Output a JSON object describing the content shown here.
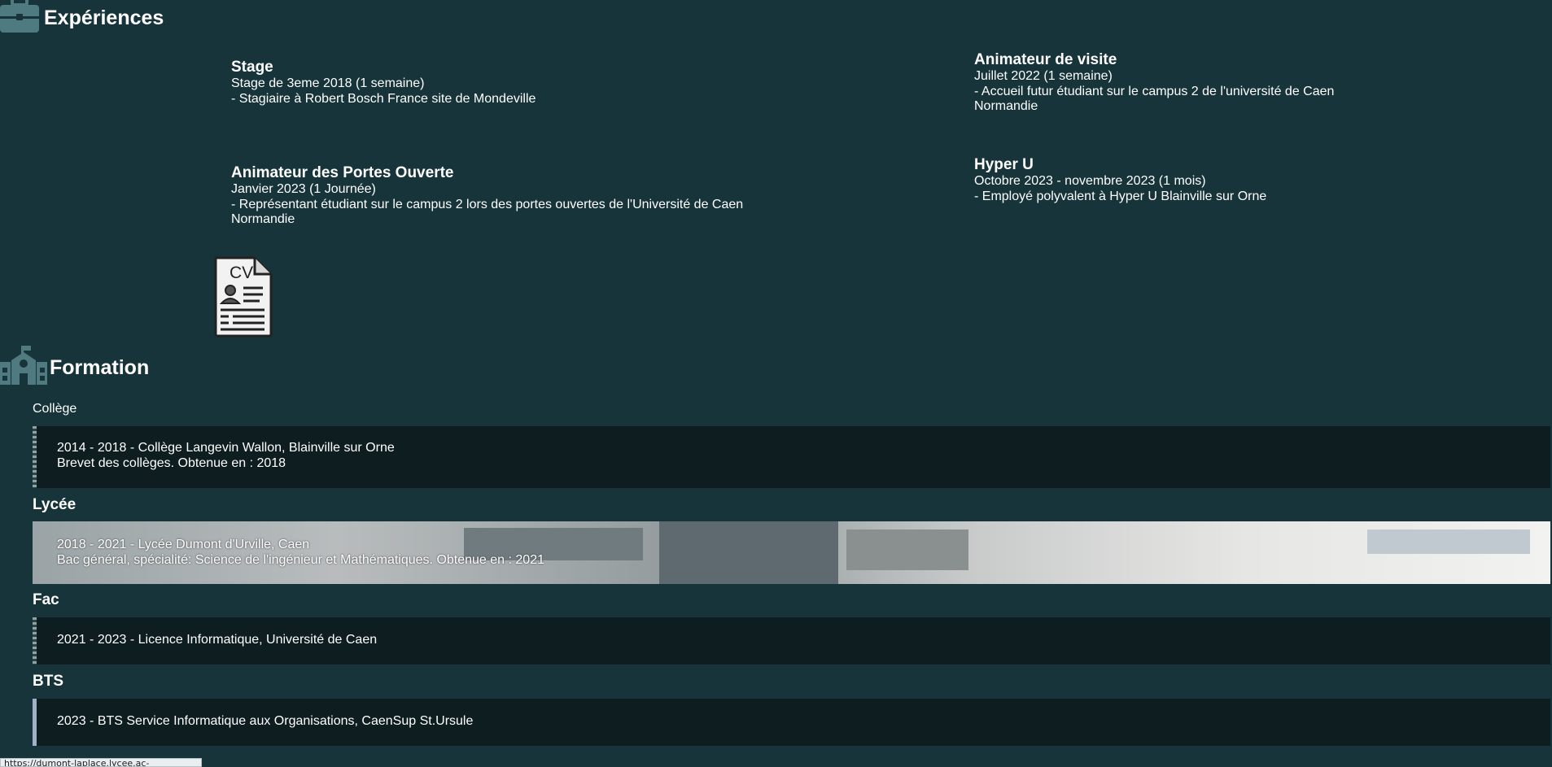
{
  "experiences": {
    "title": "Expériences",
    "jobs": [
      {
        "title": "Stage",
        "period": "Stage de 3eme 2018 (1 semaine)",
        "desc": "- Stagiaire à Robert Bosch France site de Mondeville"
      },
      {
        "title": "Animateur de visite",
        "period": "Juillet 2022 (1 semaine)",
        "desc": "- Accueil futur étudiant sur le campus 2 de l'université de Caen Normandie"
      },
      {
        "title": "Animateur des Portes Ouverte",
        "period": "Janvier 2023 (1 Journée)",
        "desc": "- Représentant étudiant sur le campus 2 lors des portes ouvertes de l'Université de Caen Normandie"
      },
      {
        "title": "Hyper U",
        "period": "Octobre 2023 - novembre 2023 (1 mois)",
        "desc": "- Employé polyvalent à Hyper U Blainville sur Orne"
      }
    ],
    "cv_label": "CV"
  },
  "formation": {
    "title": "Formation",
    "items": [
      {
        "level": "Collège",
        "line1": "2014 - 2018 - Collège Langevin Wallon, Blainville sur Orne",
        "line2": "Brevet des collèges. Obtenue en : 2018"
      },
      {
        "level": "Lycée",
        "line1": "2018 - 2021 - Lycée Dumont d'Urville, Caen",
        "line2": "Bac général, spécialité: Science de l'ingénieur et Mathématiques. Obtenue en : 2021"
      },
      {
        "level": "Fac",
        "line1": "2021 - 2023 - Licence Informatique, Université de Caen"
      },
      {
        "level": "BTS",
        "line1": "2023 - BTS Service Informatique aux Organisations, CaenSup St.Ursule"
      }
    ]
  },
  "status_bar": {
    "url": "https://dumont-laplace.lycee.ac-normandie.fr"
  },
  "icons": {
    "experience": "briefcase-icon",
    "formation": "school-icon",
    "cv": "cv-document-icon"
  },
  "colors": {
    "background": "#16343a",
    "bar": "#0d1d20",
    "icon": "#4e7a80"
  }
}
